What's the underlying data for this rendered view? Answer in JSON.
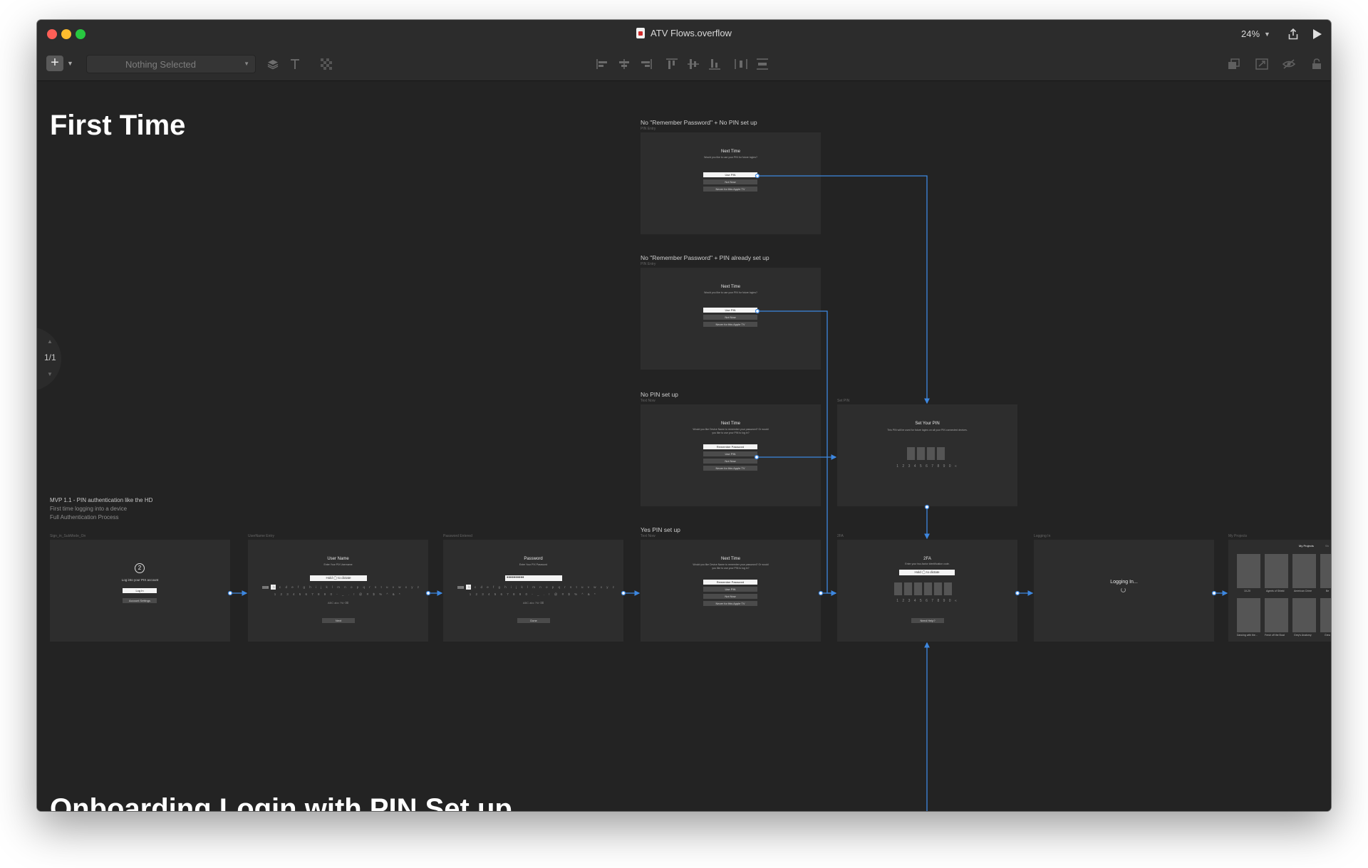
{
  "window": {
    "title": "ATV Flows.overflow",
    "zoom": "24%"
  },
  "toolbar": {
    "add_symbol": "+",
    "selection": "Nothing Selected"
  },
  "canvas": {
    "section_title": "First Time",
    "next_section_title": "Onboarding Login with PIN Set up",
    "page_indicator": "1/1",
    "note": {
      "line1": "MVP 1.1 - PIN authentication like the HD",
      "line2": "First time logging into a device",
      "line3": "Full Authentication Process"
    },
    "flows": {
      "no_remember_no_pin": "No \"Remember Password\" + No PIN set up",
      "no_remember_pin": "No \"Remember Password\" + PIN already set up",
      "no_pin": "No PIN set up",
      "yes_pin": "Yes PIN set up"
    },
    "sublabels": {
      "pin_entry": "PIN Entry",
      "pin_entry_2": "PIN Entry",
      "text_now": "Text Now",
      "text_now_2": "Text Now",
      "set_pin": "Set PIN",
      "sign_in": "Sign_in_SubMode_On",
      "username_entry": "UserName Entry",
      "password_entry": "Password Entered",
      "two_fa": "2FA",
      "logging_in": "Logging In",
      "my_projects": "My Projects"
    },
    "artboards": {
      "next_time": {
        "title": "Next Time",
        "subtitle": "Would you like to use your PIN for future logins?",
        "use_pin": "Use PIN",
        "not_now": "Not Now",
        "never": "Never for this Apple TV"
      },
      "next_time_remember": {
        "title": "Next Time",
        "subtitle_1": "Would you like Device Name to remember your password? Or would",
        "subtitle_2": "you like to use your PIN to log in?",
        "remember": "Remember Password",
        "use_pin": "Use PIN",
        "not_now": "Not Now",
        "never": "Never for this Apple TV"
      },
      "set_pin": {
        "title": "Set Your PIN",
        "subtitle": "This PIN will be used for future logins on all your PIN connected devices.",
        "digits": "1 2 3 4 5 6 7 8 9 0  «"
      },
      "login": {
        "step": "2",
        "text": "Log into your PIX account",
        "login_btn": "Log In",
        "settings_btn": "Account Settings"
      },
      "username": {
        "title": "User Name",
        "subtitle": "Enter Your PIX Username",
        "field": "Hold ◯ to dictate",
        "letters": "a b c d e f g h i j k l m n o p q r s t u v w x y z",
        "digits": "1 2 3 4 5 6 7 8 9 0   - _ . ! @ # $ % ^ & *",
        "mode_row": "ABC    abc    ?!#    ⌫",
        "next": "Next"
      },
      "password": {
        "title": "Password",
        "subtitle": "Enter Your PIX Password",
        "field": "••••••••••",
        "letters": "a b c d e f g h i j k l m n o p q r s t u v w x y z",
        "digits": "1 2 3 4 5 6 7 8 9 0   - _ . ! @ # $ % ^ & *",
        "mode_row": "ABC    abc    ?!#    ⌫",
        "done": "Done"
      },
      "two_fa": {
        "title": "2FA",
        "subtitle": "Enter your two-factor identification code.",
        "field": "Hold ◯ to dictate",
        "digits": "1 2 3 4 5 6 7 8 9 0  «",
        "help": "Need Help?"
      },
      "logging_in": {
        "text": "Logging In..."
      },
      "projects": {
        "tab_active": "My Projects",
        "tab_other": "Sh",
        "captions": [
          "10-20",
          "Agents of Shield",
          "American Crime",
          "Be",
          "Dancing with the...",
          "Fresh off the Boat",
          "Grey's Anatomy",
          "Grea"
        ]
      }
    }
  }
}
